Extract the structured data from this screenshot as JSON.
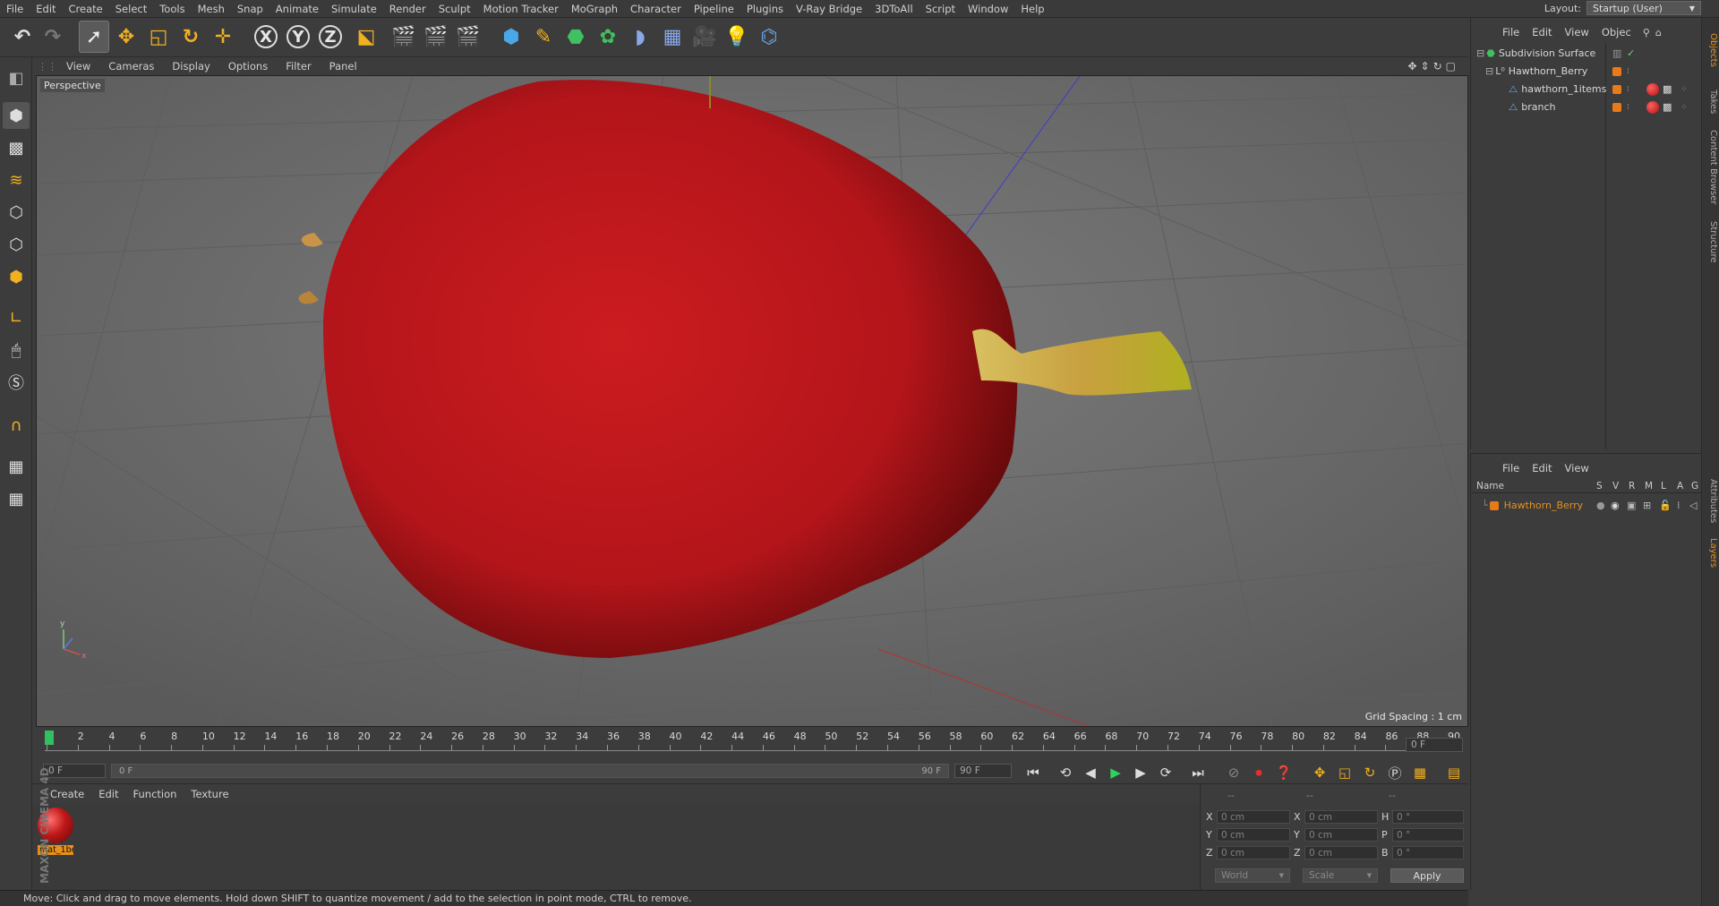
{
  "menubar": {
    "items": [
      "File",
      "Edit",
      "Create",
      "Select",
      "Tools",
      "Mesh",
      "Snap",
      "Animate",
      "Simulate",
      "Render",
      "Sculpt",
      "Motion Tracker",
      "MoGraph",
      "Character",
      "Pipeline",
      "Plugins",
      "V-Ray Bridge",
      "3DToAll",
      "Script",
      "Window",
      "Help"
    ],
    "layout_label": "Layout:",
    "layout_value": "Startup (User)"
  },
  "toolbar": {
    "x_label": "X",
    "y_label": "Y",
    "z_label": "Z"
  },
  "viewport": {
    "menu": [
      "View",
      "Cameras",
      "Display",
      "Options",
      "Filter",
      "Panel"
    ],
    "label": "Perspective",
    "grid_spacing": "Grid Spacing : 1 cm"
  },
  "timeline": {
    "ticks": [
      "0",
      "2",
      "4",
      "6",
      "8",
      "10",
      "12",
      "14",
      "16",
      "18",
      "20",
      "22",
      "24",
      "26",
      "28",
      "30",
      "32",
      "34",
      "36",
      "38",
      "40",
      "42",
      "44",
      "46",
      "48",
      "50",
      "52",
      "54",
      "56",
      "58",
      "60",
      "62",
      "64",
      "66",
      "68",
      "70",
      "72",
      "74",
      "76",
      "78",
      "80",
      "82",
      "84",
      "86",
      "88",
      "90"
    ],
    "current_frame": "0 F",
    "start_field": "0 F",
    "range_start": "0 F",
    "range_end": "90 F",
    "end_field": "90 F"
  },
  "material_manager": {
    "menu": [
      "Create",
      "Edit",
      "Function",
      "Texture"
    ],
    "material_name": "mat_1be",
    "brand": "MAXON CINEMA 4D"
  },
  "coords": {
    "dashes": [
      "--",
      "--",
      "--"
    ],
    "rows": [
      {
        "a": "X",
        "av": "0 cm",
        "b": "X",
        "bv": "0 cm",
        "c": "H",
        "cv": "0 °"
      },
      {
        "a": "Y",
        "av": "0 cm",
        "b": "Y",
        "bv": "0 cm",
        "c": "P",
        "cv": "0 °"
      },
      {
        "a": "Z",
        "av": "0 cm",
        "b": "Z",
        "bv": "0 cm",
        "c": "B",
        "cv": "0 °"
      }
    ],
    "world": "World",
    "scale": "Scale",
    "apply": "Apply"
  },
  "status": "Move: Click and drag to move elements. Hold down SHIFT to quantize movement / add to the selection in point mode, CTRL to remove.",
  "objects": {
    "menu": [
      "File",
      "Edit",
      "View",
      "Objec"
    ],
    "items": [
      {
        "name": "Subdivision Surface",
        "color": "#6fd06f"
      },
      {
        "name": "Hawthorn_Berry",
        "color": "#d0d0d0"
      },
      {
        "name": "hawthorn_1items",
        "color": "#d0d0d0"
      },
      {
        "name": "branch",
        "color": "#d0d0d0"
      }
    ]
  },
  "layers": {
    "menu": [
      "File",
      "Edit",
      "View"
    ],
    "headers": [
      "Name",
      "S",
      "V",
      "R",
      "M",
      "L",
      "A",
      "G"
    ],
    "row_name": "Hawthorn_Berry"
  },
  "right_tabs": [
    "Objects",
    "Takes",
    "Content Browser",
    "Structure",
    "Attributes",
    "Layers"
  ],
  "colors": {
    "berry": "#c0181c",
    "accent": "#e87a1a",
    "layer_name": "#e8901a"
  }
}
